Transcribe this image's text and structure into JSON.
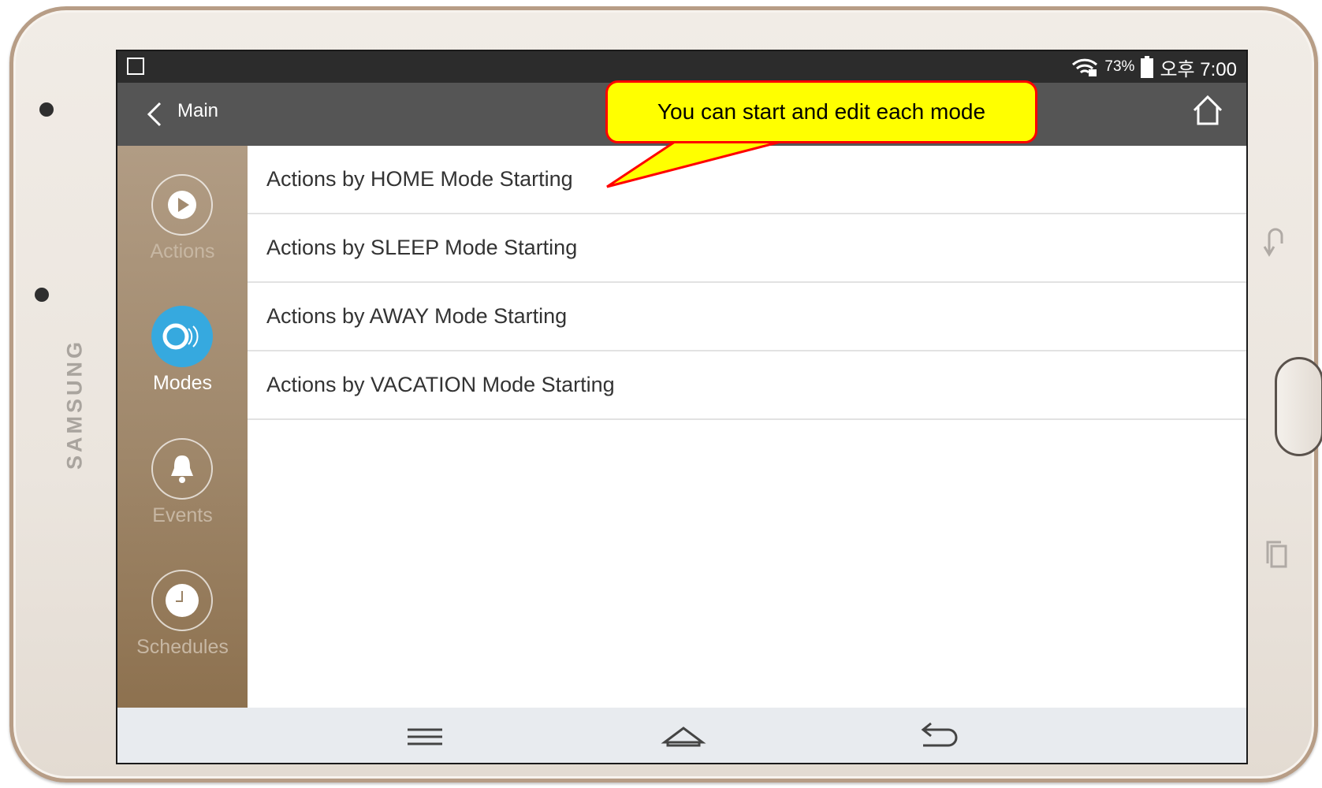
{
  "device": {
    "brand": "SAMSUNG"
  },
  "status_bar": {
    "battery_pct": "73%",
    "time": "오후 7:00"
  },
  "app_bar": {
    "back_label": "Main"
  },
  "sidebar": {
    "items": [
      {
        "label": "Actions",
        "icon": "play-icon"
      },
      {
        "label": "Modes",
        "icon": "modes-icon",
        "active": true
      },
      {
        "label": "Events",
        "icon": "bell-icon"
      },
      {
        "label": "Schedules",
        "icon": "clock-icon"
      }
    ]
  },
  "mode_list": [
    {
      "label": "Actions by HOME Mode Starting"
    },
    {
      "label": "Actions by SLEEP Mode Starting"
    },
    {
      "label": "Actions by AWAY Mode Starting"
    },
    {
      "label": "Actions by VACATION Mode Starting"
    }
  ],
  "callout": {
    "text": "You can start and edit each mode"
  },
  "colors": {
    "active_mode": "#36a9df",
    "callout_fill": "#ffff00",
    "callout_border": "#ff0000",
    "app_bar": "#555555"
  }
}
